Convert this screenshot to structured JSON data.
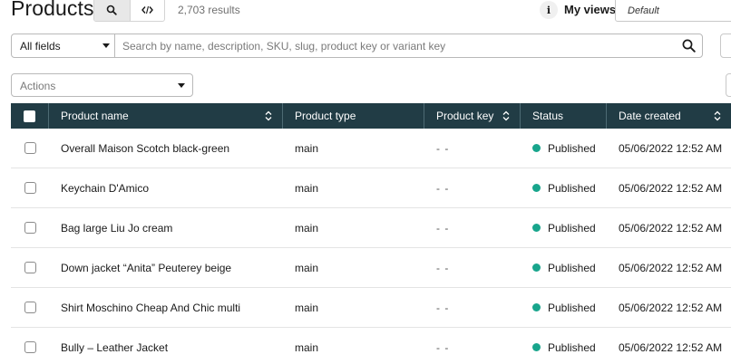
{
  "header": {
    "title": "Products",
    "search_mode_icon": "search-icon",
    "code_mode_icon": "code-icon",
    "results": "2,703 results",
    "info_icon": "info-icon",
    "info_glyph": "i",
    "my_views_label": "My views",
    "views_value": "Default"
  },
  "search": {
    "field_value": "All fields",
    "placeholder": "Search by name, description, SKU, slug, product key or variant key"
  },
  "actions": {
    "placeholder": "Actions"
  },
  "table": {
    "columns": {
      "name": "Product name",
      "type": "Product type",
      "key": "Product key",
      "status": "Status",
      "date": "Date created"
    },
    "status_color": "#18a58c",
    "header_color": "#213c45",
    "rows": [
      {
        "name": "Overall Maison Scotch black-green",
        "type": "main",
        "key": "- -",
        "status": "Published",
        "date": "05/06/2022 12:52 AM"
      },
      {
        "name": "Keychain D'Amico",
        "type": "main",
        "key": "- -",
        "status": "Published",
        "date": "05/06/2022 12:52 AM"
      },
      {
        "name": "Bag large Liu Jo cream",
        "type": "main",
        "key": "- -",
        "status": "Published",
        "date": "05/06/2022 12:52 AM"
      },
      {
        "name": "Down jacket “Anita” Peuterey beige",
        "type": "main",
        "key": "- -",
        "status": "Published",
        "date": "05/06/2022 12:52 AM"
      },
      {
        "name": "Shirt Moschino Cheap And Chic multi",
        "type": "main",
        "key": "- -",
        "status": "Published",
        "date": "05/06/2022 12:52 AM"
      },
      {
        "name": "Bully – Leather Jacket",
        "type": "main",
        "key": "- -",
        "status": "Published",
        "date": "05/06/2022 12:52 AM"
      }
    ]
  }
}
